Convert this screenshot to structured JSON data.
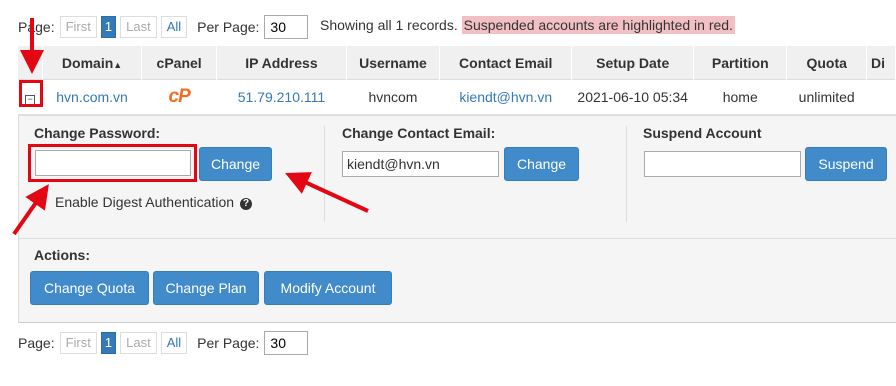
{
  "pager": {
    "page_label": "Page:",
    "first": "First",
    "current": "1",
    "last": "Last",
    "all": "All",
    "per_page_label": "Per Page:",
    "per_page_value": "30"
  },
  "status": {
    "showing": "Showing all 1 records.",
    "suspended_note": "Suspended accounts are highlighted in red."
  },
  "table": {
    "headers": {
      "domain": "Domain",
      "domain_sort": "▲",
      "cpanel": "cPanel",
      "ip": "IP Address",
      "username": "Username",
      "contact_email": "Contact Email",
      "setup_date": "Setup Date",
      "partition": "Partition",
      "quota": "Quota",
      "disk": "Di"
    },
    "row": {
      "expand": "−",
      "domain": "hvn.com.vn",
      "cpanel_logo": "cP",
      "ip": "51.79.210.111",
      "username": "hvncom",
      "contact_email": "kiendt@hvn.vn",
      "setup_date": "2021-06-10 05:34",
      "partition": "home",
      "quota": "unlimited"
    }
  },
  "panel": {
    "change_password": {
      "title": "Change Password:",
      "value": "",
      "button": "Change",
      "digest_label": "Enable Digest Authentication",
      "help_icon": "?"
    },
    "change_email": {
      "title": "Change Contact Email:",
      "value": "kiendt@hvn.vn",
      "button": "Change"
    },
    "suspend": {
      "title": "Suspend Account",
      "value": "",
      "button": "Suspend"
    },
    "actions": {
      "title": "Actions:",
      "buttons": [
        "Change Quota",
        "Change Plan",
        "Modify Account"
      ]
    }
  },
  "annotation_color": "#e30613"
}
